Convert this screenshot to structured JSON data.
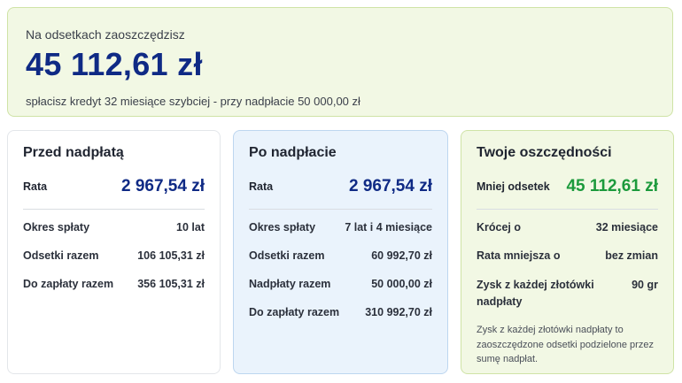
{
  "summary": {
    "label": "Na odsetkach zaoszczędzisz",
    "amount": "45 112,61 zł",
    "subtitle": "spłacisz kredyt 32 miesiące szybciej - przy nadpłacie 50 000,00 zł"
  },
  "before": {
    "title": "Przed nadpłatą",
    "main": {
      "label": "Rata",
      "value": "2 967,54 zł"
    },
    "rows": [
      {
        "label": "Okres spłaty",
        "value": "10 lat"
      },
      {
        "label": "Odsetki razem",
        "value": "106 105,31 zł"
      },
      {
        "label": "Do zapłaty razem",
        "value": "356 105,31 zł"
      }
    ]
  },
  "after": {
    "title": "Po nadpłacie",
    "main": {
      "label": "Rata",
      "value": "2 967,54 zł"
    },
    "rows": [
      {
        "label": "Okres spłaty",
        "value": "7 lat i 4 miesiące"
      },
      {
        "label": "Odsetki razem",
        "value": "60 992,70 zł"
      },
      {
        "label": "Nadpłaty razem",
        "value": "50 000,00 zł"
      },
      {
        "label": "Do zapłaty razem",
        "value": "310 992,70 zł"
      }
    ]
  },
  "savings": {
    "title": "Twoje oszczędności",
    "main": {
      "label": "Mniej odsetek",
      "value": "45 112,61 zł"
    },
    "rows": [
      {
        "label": "Krócej o",
        "value": "32 miesiące"
      },
      {
        "label": "Rata mniejsza o",
        "value": "bez zmian"
      },
      {
        "label": "Zysk z każdej złotówki nadpłaty",
        "value": "90 gr"
      }
    ],
    "note": "Zysk z każdej złotówki nadpłaty to zaoszczędzone odsetki podzielone przez sumę nadpłat."
  },
  "colors": {
    "primary_amount": "#0f2a85",
    "savings_amount": "#1c9a3c",
    "green_panel": "#f2f8e4",
    "blue_panel": "#eaf3fc"
  }
}
